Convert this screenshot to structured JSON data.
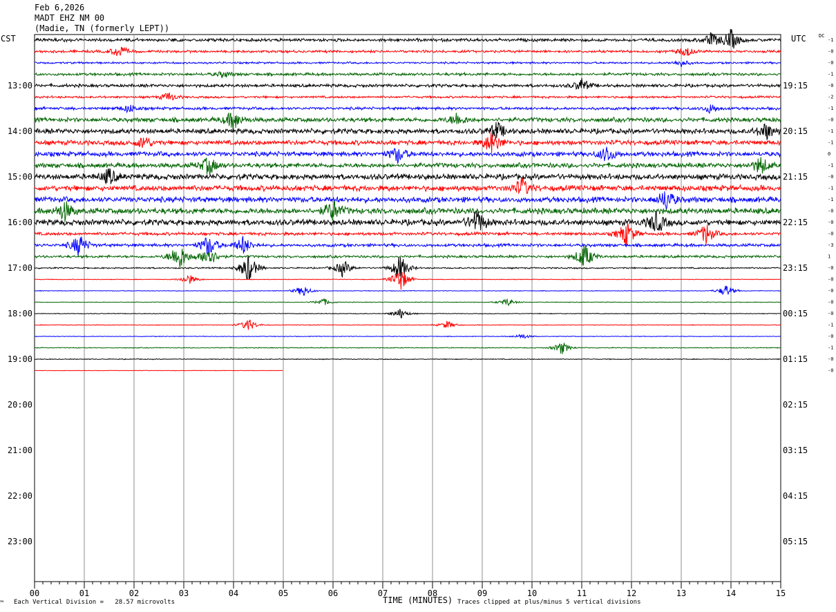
{
  "header": {
    "date": "Feb 6,2026",
    "station": "MADT EHZ NM 00",
    "location": "(Madie, TN (formerly LEPT))"
  },
  "left_corner_label": "CST",
  "right_corner_label": "UTC",
  "dc_label": "DC",
  "x_axis_title": "TIME (MINUTES)",
  "footer": {
    "division_note": "Each Vertical Division =   28.57 microvolts",
    "clip_note": "Traces clipped at plus/minus 5 vertical divisions",
    "corner_mark": "™"
  },
  "chart_data": {
    "type": "line",
    "title": "",
    "xlabel": "TIME (MINUTES)",
    "xlim": [
      0,
      15
    ],
    "x_ticks": [
      "00",
      "01",
      "02",
      "03",
      "04",
      "05",
      "06",
      "07",
      "08",
      "09",
      "10",
      "11",
      "12",
      "13",
      "14",
      "15"
    ],
    "rows_per_hour": 4,
    "minutes_per_row": 15,
    "left_hour_labels": [
      "13:00",
      "14:00",
      "15:00",
      "16:00",
      "17:00",
      "18:00",
      "19:00",
      "20:00",
      "21:00",
      "22:00",
      "23:00"
    ],
    "right_hour_labels": [
      "19:15",
      "20:15",
      "21:15",
      "22:15",
      "23:15",
      "00:15",
      "01:15",
      "02:15",
      "03:15",
      "04:15",
      "05:15"
    ],
    "trace_colors": [
      "#000000",
      "#ff0000",
      "#0000ff",
      "#006400"
    ],
    "dc_offsets": [
      "-1",
      "-0",
      "-0",
      "-1",
      "-0",
      "-2",
      "-1",
      "-0",
      "-1",
      "-1",
      "0",
      "-1",
      "-0",
      "-1",
      "-1",
      "-0",
      "-0",
      "-0",
      "-3",
      "1",
      "-0",
      "-0",
      "-0",
      "-0",
      "-0",
      "-1",
      "-0",
      "-1",
      "-0",
      "-0"
    ],
    "traces": [
      {
        "start_time": "12:00",
        "amplitude": 0.55,
        "end_minute": 15,
        "events": [
          {
            "minute": 14.0,
            "strength": 1.6
          },
          {
            "minute": 13.6,
            "strength": 1.0
          }
        ]
      },
      {
        "start_time": "12:15",
        "amplitude": 0.45,
        "end_minute": 15,
        "events": [
          {
            "minute": 1.7,
            "strength": 1.0
          },
          {
            "minute": 13.1,
            "strength": 0.8
          }
        ]
      },
      {
        "start_time": "12:30",
        "amplitude": 0.35,
        "end_minute": 15,
        "events": [
          {
            "minute": 13.0,
            "strength": 0.5
          }
        ]
      },
      {
        "start_time": "12:45",
        "amplitude": 0.5,
        "end_minute": 15,
        "events": [
          {
            "minute": 3.8,
            "strength": 0.5
          }
        ]
      },
      {
        "start_time": "13:00",
        "amplitude": 0.55,
        "end_minute": 15,
        "events": [
          {
            "minute": 11.0,
            "strength": 1.0
          }
        ]
      },
      {
        "start_time": "13:15",
        "amplitude": 0.4,
        "end_minute": 15,
        "events": [
          {
            "minute": 2.7,
            "strength": 0.7
          }
        ]
      },
      {
        "start_time": "13:30",
        "amplitude": 0.5,
        "end_minute": 15,
        "events": [
          {
            "minute": 1.9,
            "strength": 0.6
          },
          {
            "minute": 13.6,
            "strength": 0.7
          }
        ]
      },
      {
        "start_time": "13:45",
        "amplitude": 0.8,
        "end_minute": 15,
        "events": [
          {
            "minute": 4.0,
            "strength": 1.5
          },
          {
            "minute": 8.5,
            "strength": 1.0
          }
        ]
      },
      {
        "start_time": "14:00",
        "amplitude": 0.9,
        "end_minute": 15,
        "events": [
          {
            "minute": 9.3,
            "strength": 1.3
          },
          {
            "minute": 14.7,
            "strength": 1.3
          }
        ]
      },
      {
        "start_time": "14:15",
        "amplitude": 0.85,
        "end_minute": 15,
        "events": [
          {
            "minute": 9.2,
            "strength": 2.0
          },
          {
            "minute": 2.2,
            "strength": 1.0
          }
        ]
      },
      {
        "start_time": "14:30",
        "amplitude": 0.85,
        "end_minute": 15,
        "events": [
          {
            "minute": 7.3,
            "strength": 1.2
          },
          {
            "minute": 11.5,
            "strength": 1.2
          }
        ]
      },
      {
        "start_time": "14:45",
        "amplitude": 0.85,
        "end_minute": 15,
        "events": [
          {
            "minute": 3.5,
            "strength": 1.4
          },
          {
            "minute": 14.6,
            "strength": 1.3
          }
        ]
      },
      {
        "start_time": "15:00",
        "amplitude": 1.0,
        "end_minute": 15,
        "events": [
          {
            "minute": 1.5,
            "strength": 1.2
          }
        ]
      },
      {
        "start_time": "15:15",
        "amplitude": 1.0,
        "end_minute": 15,
        "events": [
          {
            "minute": 9.8,
            "strength": 1.4
          }
        ]
      },
      {
        "start_time": "15:30",
        "amplitude": 1.0,
        "end_minute": 15,
        "events": [
          {
            "minute": 12.7,
            "strength": 1.6
          }
        ]
      },
      {
        "start_time": "15:45",
        "amplitude": 1.05,
        "end_minute": 15,
        "events": [
          {
            "minute": 0.6,
            "strength": 1.5
          },
          {
            "minute": 6.0,
            "strength": 1.6
          }
        ]
      },
      {
        "start_time": "16:00",
        "amplitude": 1.05,
        "end_minute": 15,
        "events": [
          {
            "minute": 8.9,
            "strength": 2.0
          },
          {
            "minute": 12.5,
            "strength": 1.8
          }
        ]
      },
      {
        "start_time": "16:15",
        "amplitude": 0.55,
        "end_minute": 15,
        "events": [
          {
            "minute": 11.9,
            "strength": 2.0
          },
          {
            "minute": 13.5,
            "strength": 1.6
          }
        ]
      },
      {
        "start_time": "16:30",
        "amplitude": 0.55,
        "end_minute": 15,
        "events": [
          {
            "minute": 0.9,
            "strength": 1.8
          },
          {
            "minute": 3.5,
            "strength": 1.8
          },
          {
            "minute": 4.2,
            "strength": 1.4
          }
        ]
      },
      {
        "start_time": "16:45",
        "amplitude": 0.45,
        "end_minute": 15,
        "events": [
          {
            "minute": 2.9,
            "strength": 2.5
          },
          {
            "minute": 3.5,
            "strength": 1.8
          },
          {
            "minute": 11.05,
            "strength": 2.2
          }
        ]
      },
      {
        "start_time": "17:00",
        "amplitude": 0.25,
        "end_minute": 15,
        "events": [
          {
            "minute": 4.3,
            "strength": 2.5
          },
          {
            "minute": 6.2,
            "strength": 1.3
          },
          {
            "minute": 7.35,
            "strength": 2.2
          }
        ]
      },
      {
        "start_time": "17:15",
        "amplitude": 0.12,
        "end_minute": 15,
        "events": [
          {
            "minute": 3.1,
            "strength": 0.8
          },
          {
            "minute": 7.35,
            "strength": 2.0
          }
        ]
      },
      {
        "start_time": "17:30",
        "amplitude": 0.12,
        "end_minute": 15,
        "events": [
          {
            "minute": 5.4,
            "strength": 0.9
          },
          {
            "minute": 13.9,
            "strength": 0.9
          }
        ]
      },
      {
        "start_time": "17:45",
        "amplitude": 0.12,
        "end_minute": 15,
        "events": [
          {
            "minute": 5.8,
            "strength": 0.6
          },
          {
            "minute": 9.5,
            "strength": 0.6
          }
        ]
      },
      {
        "start_time": "18:00",
        "amplitude": 0.12,
        "end_minute": 15,
        "events": [
          {
            "minute": 7.35,
            "strength": 0.8
          }
        ]
      },
      {
        "start_time": "18:15",
        "amplitude": 0.12,
        "end_minute": 15,
        "events": [
          {
            "minute": 4.3,
            "strength": 1.0
          },
          {
            "minute": 8.3,
            "strength": 0.6
          }
        ]
      },
      {
        "start_time": "18:30",
        "amplitude": 0.12,
        "end_minute": 15,
        "events": [
          {
            "minute": 9.8,
            "strength": 0.4
          }
        ]
      },
      {
        "start_time": "18:45",
        "amplitude": 0.15,
        "end_minute": 15,
        "events": [
          {
            "minute": 10.6,
            "strength": 1.0
          }
        ]
      },
      {
        "start_time": "19:00",
        "amplitude": 0.15,
        "end_minute": 15,
        "events": []
      },
      {
        "start_time": "19:15",
        "amplitude": 0.08,
        "end_minute": 5,
        "events": []
      }
    ]
  }
}
